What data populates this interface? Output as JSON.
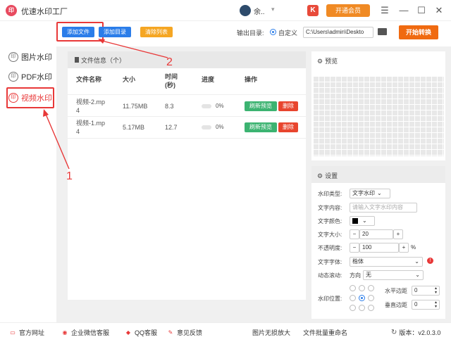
{
  "app": {
    "logo_text": "印",
    "title": "优速水印工厂",
    "user_name": "余..",
    "user_caret": "▾",
    "k_icon": "K",
    "vip_label": "开通会员",
    "menu_glyph": "☰",
    "min_glyph": "—",
    "max_glyph": "☐",
    "close_glyph": "✕"
  },
  "toolbar": {
    "add_file": "添加文件",
    "add_dir": "添加目录",
    "clear_list": "清除列表",
    "output_label": "输出目录:",
    "output_custom": "自定义",
    "output_path": "C:\\Users\\admin\\Deskto",
    "start": "开始转换"
  },
  "sidebar": {
    "items": [
      {
        "icon_text": "印",
        "label": "图片水印"
      },
      {
        "icon_text": "印",
        "label": "PDF水印"
      },
      {
        "icon_text": "印",
        "label": "视频水印"
      }
    ]
  },
  "filelist": {
    "header": "文件信息（个）",
    "columns": [
      "文件名称",
      "大小",
      "时间\n(秒)",
      "进度",
      "操作"
    ],
    "rows": [
      {
        "name": "视频-2.mp\n4",
        "size": "11.75MB",
        "time": "8.3",
        "progress": "0%",
        "refresh": "刷新预览",
        "delete": "删除"
      },
      {
        "name": "视频-1.mp\n4",
        "size": "5.17MB",
        "time": "12.7",
        "progress": "0%",
        "refresh": "刷新预览",
        "delete": "删除"
      }
    ]
  },
  "preview": {
    "title": "预览"
  },
  "settings": {
    "title": "设置",
    "type_label": "水印类型:",
    "type_value": "文字水印",
    "text_label": "文字内容:",
    "text_placeholder": "请输入文字水印内容",
    "color_label": "文字颜色:",
    "size_label": "文字大小:",
    "size_value": "20",
    "opacity_label": "不透明度:",
    "opacity_value": "100",
    "opacity_unit": "%",
    "font_label": "文字字体:",
    "font_value": "楷体",
    "scroll_label": "动态滚动:",
    "scroll_dir": "方向",
    "scroll_value": "无",
    "pos_label": "水印位置:",
    "hmargin_label": "水平边距",
    "hmargin_value": "0",
    "vmargin_label": "垂直边距",
    "vmargin_value": "0",
    "minus": "−",
    "plus": "+",
    "caret": "⌄",
    "warn": "!"
  },
  "footer": {
    "links": [
      "官方网址",
      "企业微信客服",
      "QQ客服",
      "意见反馈",
      "图片无损放大",
      "文件批量重命名"
    ],
    "version": "版本：v2.0.3.0"
  },
  "annotations": {
    "one": "1",
    "two": "2"
  },
  "colors": {
    "blue": "#2b7de9",
    "orange": "#f5a623",
    "green": "#3cb371",
    "red": "#e83838",
    "start": "#f06a10"
  }
}
